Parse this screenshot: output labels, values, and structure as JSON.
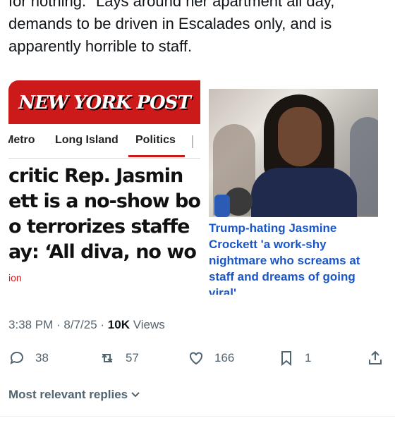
{
  "tweet": {
    "lines": [
      "for nothing. \"Lays around her apartment all day,\"",
      "demands to be driven in Escalades only, and is",
      "apparently horrible to staff."
    ]
  },
  "left_image": {
    "logo": "NEW YORK POST",
    "nav": [
      "Metro",
      "Long Island",
      "Politics"
    ],
    "active_nav": "Politics",
    "headline_lines": [
      "critic Rep. Jasmin",
      "ett is a no-show bos",
      "o terrorizes staffe",
      "ay: ‘All diva, no wo"
    ],
    "tag": "ion",
    "brand_color": "#cc1a1a"
  },
  "right_image": {
    "caption_lines": [
      "Trump-hating Jasmine",
      "Crockett 'a work-shy",
      "nightmare who screams at",
      "staff and dreams of going",
      "viral'"
    ],
    "caption_color": "#1a56c7"
  },
  "meta": {
    "time": "3:38 PM",
    "date": "8/7/25",
    "views_count": "10K",
    "views_label": "Views"
  },
  "actions": {
    "reply_count": "38",
    "retweet_count": "57",
    "like_count": "166",
    "bookmark_count": "1"
  },
  "replies_sort_label": "Most relevant replies"
}
